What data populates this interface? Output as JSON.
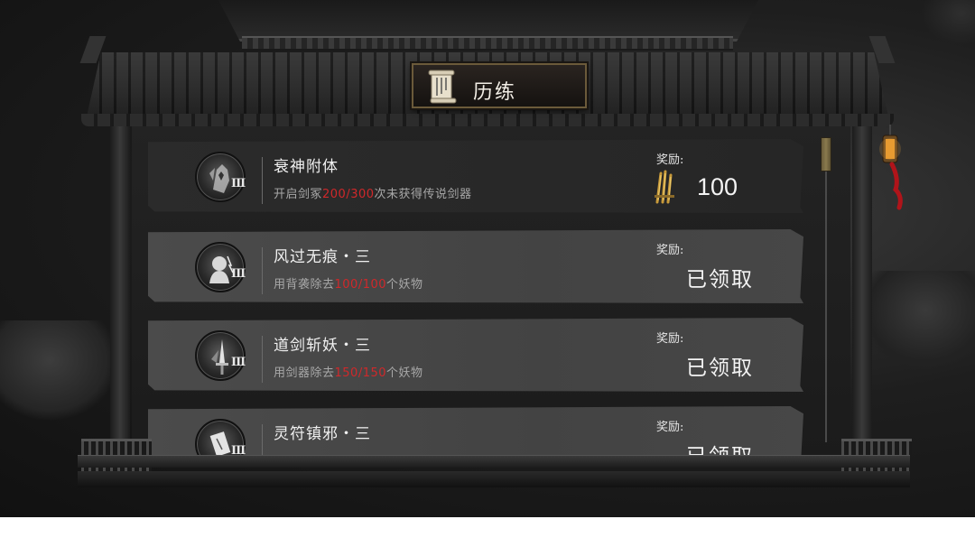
{
  "title": "历练",
  "reward_label": "奖励:",
  "tasks": [
    {
      "name": "衰神附体",
      "desc_prefix": "开启剑冢",
      "progress": "200/300",
      "desc_suffix": "次未获得传说剑器",
      "tier": "III",
      "icon": "ghost-mask-icon",
      "reward_type": "currency",
      "reward_value": "100",
      "reward_icon": "golden-swords-icon",
      "state": "in-progress"
    },
    {
      "name": "风过无痕・三",
      "desc_prefix": "用背袭除去",
      "progress": "100/100",
      "desc_suffix": "个妖物",
      "tier": "III",
      "icon": "shadow-figure-icon",
      "reward_type": "status",
      "reward_value": "已领取",
      "state": "claimed"
    },
    {
      "name": "道剑斩妖・三",
      "desc_prefix": "用剑器除去",
      "progress": "150/150",
      "desc_suffix": "个妖物",
      "tier": "III",
      "icon": "sword-icon",
      "reward_type": "status",
      "reward_value": "已领取",
      "state": "claimed"
    },
    {
      "name": "灵符镇邪・三",
      "desc_prefix": "",
      "progress": "",
      "desc_suffix": "",
      "tier": "III",
      "icon": "talisman-icon",
      "reward_type": "status",
      "reward_value": "已领取",
      "state": "claimed"
    }
  ],
  "colors": {
    "progress": "#d0282a",
    "accent_gold": "#8a7a4e"
  }
}
